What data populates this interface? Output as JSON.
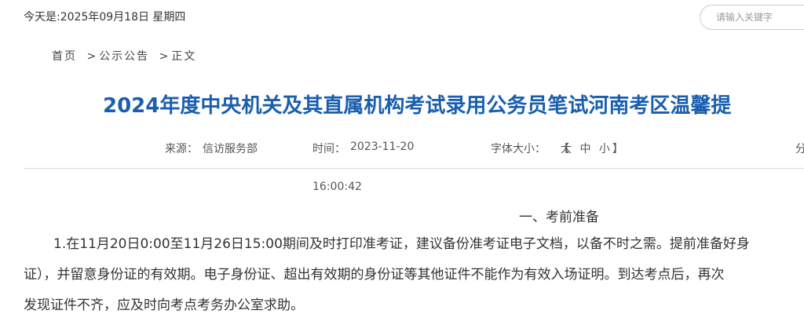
{
  "header": {
    "date_text": "今天是:2025年09月18日 星期四",
    "search_placeholder": "请输入关键字"
  },
  "breadcrumb": {
    "items": [
      "首页",
      "公示公告",
      "正文"
    ],
    "separator": ">"
  },
  "article": {
    "title": "2024年度中央机关及其直属机构考试录用公务员笔试河南考区温馨提",
    "meta": {
      "source_label": "来源：",
      "source_value": "信访服务部",
      "time_label": "时间：",
      "time_value": "2023-11-20",
      "time_value_cont": "16:00:42",
      "font_size_label": "字体大小：",
      "font_open_bracket": "【",
      "font_sizes": [
        "大",
        "中",
        "小"
      ],
      "font_close_bracket": "】",
      "share_partial": "分"
    },
    "section_heading": "一、考前准备",
    "paragraph_lines": [
      "1.在11月20日0:00至11月26日15:00期间及时打印准考证，建议备份准考证电子文档，以备不时之需。提前准备好身",
      "证），并留意身份证的有效期。电子身份证、超出有效期的身份证等其他证件不能作为有效入场证明。到达考点后，再次",
      "发现证件不齐，应及时向考点考务办公室求助。"
    ]
  },
  "colors": {
    "title": "#1a5fae",
    "text": "#333333",
    "divider": "#d8d8d8"
  }
}
